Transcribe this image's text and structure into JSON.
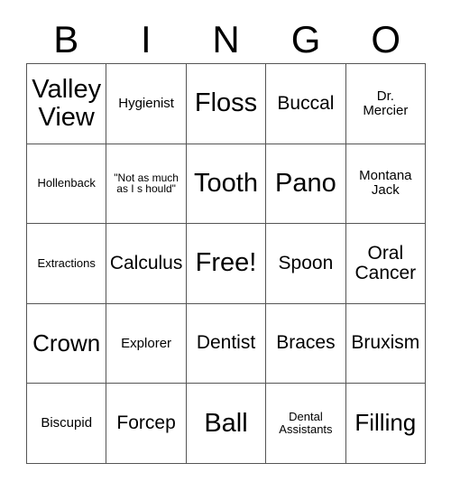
{
  "card": {
    "title": "BINGO",
    "header_letters": [
      "B",
      "I",
      "N",
      "G",
      "O"
    ],
    "columns": [
      "B",
      "I",
      "N",
      "G",
      "O"
    ],
    "free_space": "Free!",
    "free_space_position": {
      "row": 3,
      "column": 3
    },
    "grid_size": "5x5",
    "colors": {
      "background": "#ffffff",
      "text": "#000000",
      "grid_line": "#555555"
    },
    "rows": [
      [
        {
          "text": "Valley\nView",
          "size": "xl"
        },
        {
          "text": "Hygienist",
          "size": "sm"
        },
        {
          "text": "Floss",
          "size": "xl"
        },
        {
          "text": "Buccal",
          "size": "md"
        },
        {
          "text": "Dr.\nMercier",
          "size": "sm"
        }
      ],
      [
        {
          "text": "Hollenback",
          "size": "xs"
        },
        {
          "text": "\"Not as much as I s hould\"",
          "size": "xxs"
        },
        {
          "text": "Tooth",
          "size": "xl"
        },
        {
          "text": "Pano",
          "size": "xl"
        },
        {
          "text": "Montana\nJack",
          "size": "sm"
        }
      ],
      [
        {
          "text": "Extractions",
          "size": "xs"
        },
        {
          "text": "Calculus",
          "size": "md"
        },
        {
          "text": "Free!",
          "size": "xl"
        },
        {
          "text": "Spoon",
          "size": "md"
        },
        {
          "text": "Oral\nCancer",
          "size": "md"
        }
      ],
      [
        {
          "text": "Crown",
          "size": "lg"
        },
        {
          "text": "Explorer",
          "size": "sm"
        },
        {
          "text": "Dentist",
          "size": "md"
        },
        {
          "text": "Braces",
          "size": "md"
        },
        {
          "text": "Bruxism",
          "size": "md"
        }
      ],
      [
        {
          "text": "Biscupid",
          "size": "sm"
        },
        {
          "text": "Forcep",
          "size": "md"
        },
        {
          "text": "Ball",
          "size": "xl"
        },
        {
          "text": "Dental\nAssistants",
          "size": "xs"
        },
        {
          "text": "Filling",
          "size": "lg"
        }
      ]
    ]
  }
}
